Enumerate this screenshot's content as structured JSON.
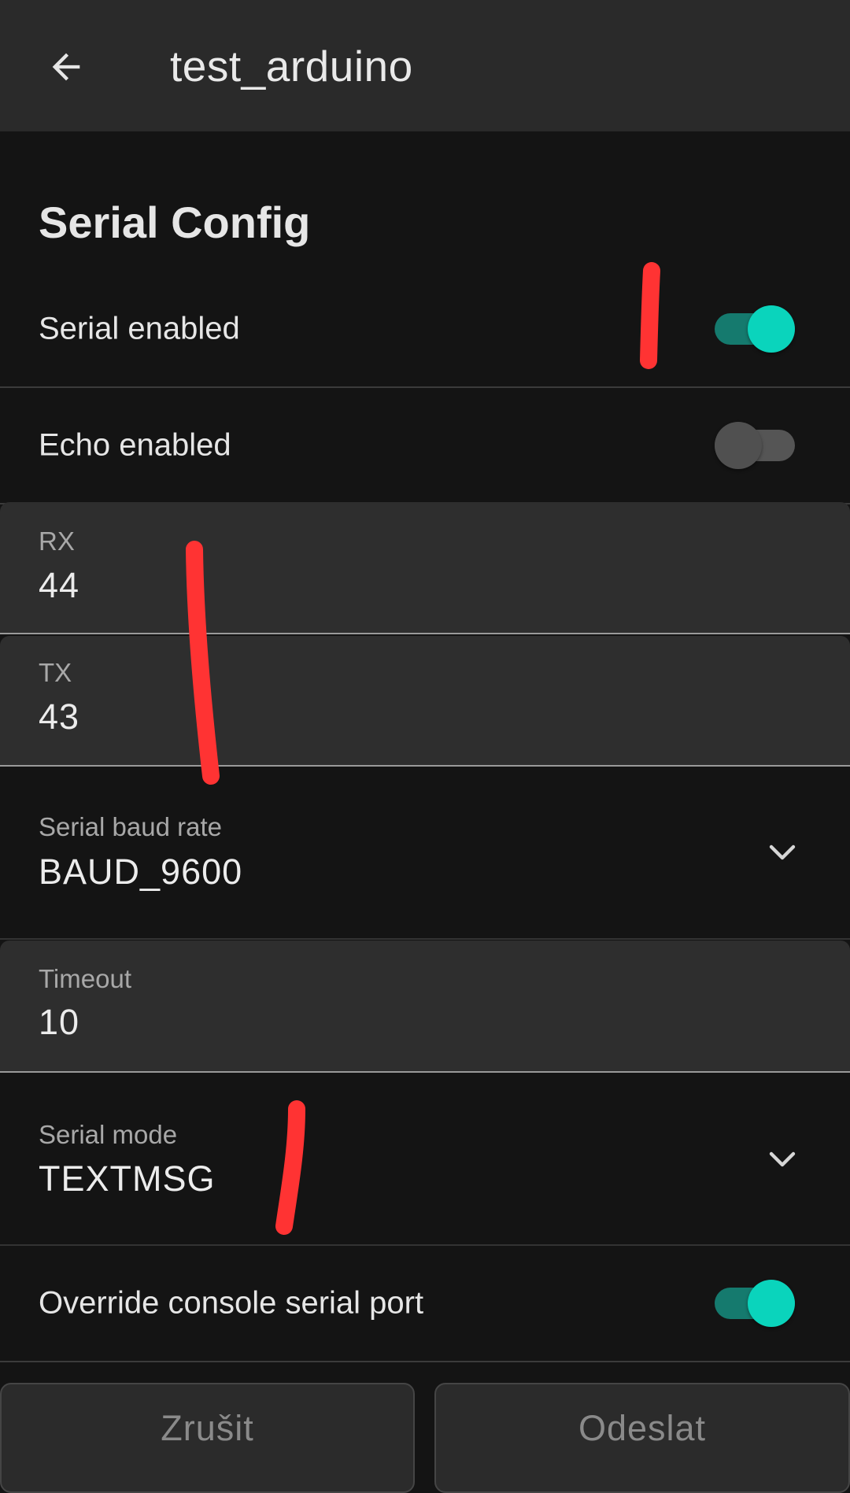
{
  "appbar": {
    "title": "test_arduino",
    "back_icon": "arrow-left-icon"
  },
  "section": {
    "title": "Serial Config"
  },
  "serial_enabled": {
    "label": "Serial enabled",
    "checked": true
  },
  "echo_enabled": {
    "label": "Echo enabled",
    "checked": false
  },
  "rx": {
    "label": "RX",
    "value": "44"
  },
  "tx": {
    "label": "TX",
    "value": "43"
  },
  "baud_rate": {
    "label": "Serial baud rate",
    "value": "BAUD_9600",
    "icon": "chevron-down-icon"
  },
  "timeout": {
    "label": "Timeout",
    "value": "10"
  },
  "serial_mode": {
    "label": "Serial mode",
    "value": "TEXTMSG",
    "icon": "chevron-down-icon"
  },
  "override_console": {
    "label": "Override console serial port",
    "checked": true
  },
  "buttons": {
    "cancel": "Zrušit",
    "send": "Odeslat"
  },
  "colors": {
    "accent": "#0ad4bc",
    "accent_track": "#157a6e",
    "annotation": "#ff3333",
    "background": "#141414",
    "appbar": "#2a2a2a"
  }
}
